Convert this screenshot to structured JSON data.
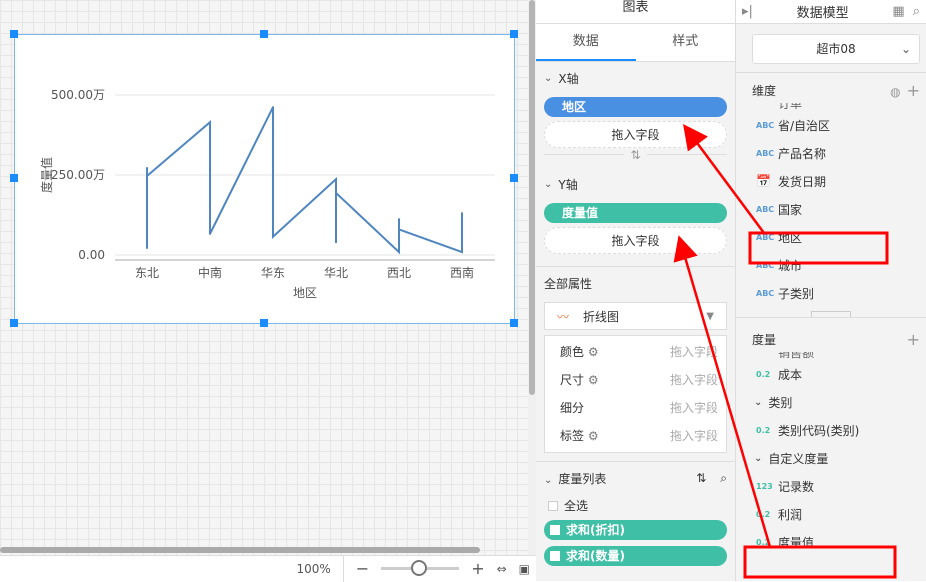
{
  "chart_panel": {
    "title": "图表",
    "tabs": [
      "数据",
      "样式"
    ],
    "x_axis": {
      "label": "X轴",
      "field": "地区",
      "drop_hint": "拖入字段",
      "field_color": "#4a90e2"
    },
    "y_axis": {
      "label": "Y轴",
      "field": "度量值",
      "drop_hint": "拖入字段",
      "field_color": "#3fbfa5"
    },
    "all_props": {
      "label": "全部属性",
      "chart_type": "折线图",
      "rows": [
        {
          "label": "颜色",
          "gear": true,
          "hint": "拖入字段"
        },
        {
          "label": "尺寸",
          "gear": true,
          "hint": "拖入字段"
        },
        {
          "label": "细分",
          "gear": false,
          "hint": "拖入字段"
        },
        {
          "label": "标签",
          "gear": true,
          "hint": "拖入字段"
        }
      ]
    },
    "measure_list": {
      "label": "度量列表",
      "select_all": "全选",
      "items": [
        "求和(折扣)",
        "求和(数量)"
      ]
    }
  },
  "model_panel": {
    "title": "数据模型",
    "dataset": "超市08",
    "dimensions": {
      "label": "维度",
      "partial_item": "订单",
      "items": [
        {
          "type": "ABC",
          "name": "省/自治区"
        },
        {
          "type": "ABC",
          "name": "产品名称"
        },
        {
          "type": "date",
          "name": "发货日期"
        },
        {
          "type": "ABC",
          "name": "国家"
        },
        {
          "type": "ABC",
          "name": "地区"
        },
        {
          "type": "ABC",
          "name": "城市"
        },
        {
          "type": "ABC",
          "name": "子类别"
        }
      ]
    },
    "measures": {
      "label": "度量",
      "partial_item": "销售额",
      "items": [
        {
          "kind": "item",
          "type": "0.2",
          "name": "成本"
        },
        {
          "kind": "group",
          "name": "类别"
        },
        {
          "kind": "item",
          "type": "0.2",
          "name": "类别代码(类别)"
        },
        {
          "kind": "group",
          "name": "自定义度量"
        },
        {
          "kind": "item",
          "type": "123",
          "name": "记录数"
        },
        {
          "kind": "item",
          "type": "0.2",
          "name": "利润"
        },
        {
          "kind": "item",
          "type": "0.2",
          "name": "度量值"
        }
      ]
    }
  },
  "zoom": {
    "level": "100%",
    "slider_fraction": 0.5,
    "minus": "−",
    "plus": "+"
  },
  "chart_data": {
    "type": "line",
    "xlabel": "地区",
    "ylabel": "度量值",
    "yticks": [
      "0.00",
      "250.00万",
      "500.00万"
    ],
    "ylim": [
      0,
      5000000
    ],
    "categories": [
      "东北",
      "中南",
      "华东",
      "华北",
      "西北",
      "西南"
    ],
    "color": "#4f86c0",
    "points": [
      [
        0,
        220000
      ],
      [
        0,
        2720000
      ],
      [
        0,
        2470000
      ],
      [
        1,
        4150000
      ],
      [
        1,
        3450000
      ],
      [
        1,
        660000
      ],
      [
        2,
        4620000
      ],
      [
        2,
        4000000
      ],
      [
        2,
        570000
      ],
      [
        3,
        2370000
      ],
      [
        3,
        400000
      ],
      [
        3,
        1940000
      ],
      [
        4,
        90000
      ],
      [
        4,
        1120000
      ],
      [
        4,
        800000
      ],
      [
        5,
        90000
      ],
      [
        5,
        1310000
      ]
    ]
  }
}
